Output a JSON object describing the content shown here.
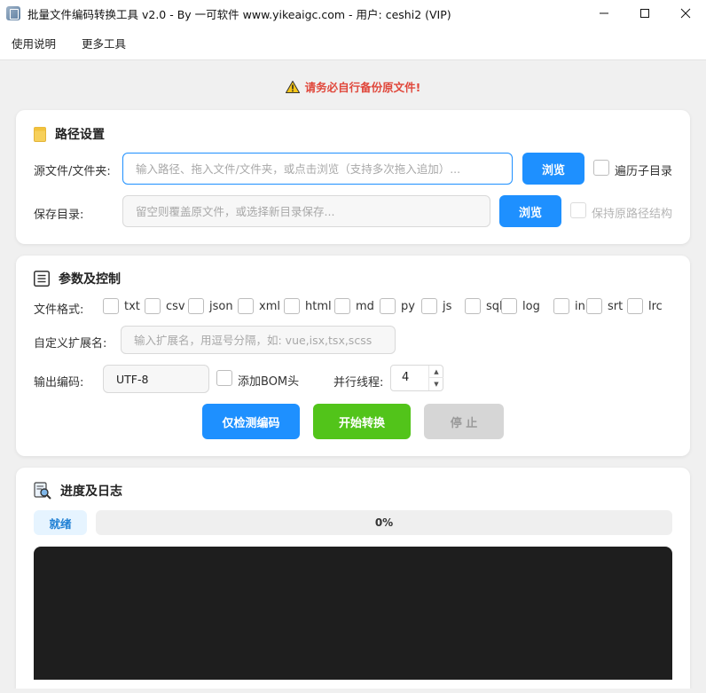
{
  "window": {
    "title": "批量文件编码转换工具 v2.0 - By 一可软件 www.yikeaigc.com - 用户: ceshi2 (VIP)"
  },
  "menu": {
    "items": [
      "使用说明",
      "更多工具"
    ]
  },
  "warning": {
    "text": "请务必自行备份原文件!"
  },
  "path_section": {
    "title": "路径设置",
    "source_label": "源文件/文件夹:",
    "source_placeholder": "输入路径、拖入文件/文件夹，或点击浏览（支持多次拖入追加）...",
    "browse_label": "浏览",
    "recurse_label": "遍历子目录",
    "save_label": "保存目录:",
    "save_placeholder": "留空则覆盖原文件，或选择新目录保存...",
    "browse2_label": "浏览",
    "keep_structure_label": "保持原路径结构"
  },
  "params_section": {
    "title": "参数及控制",
    "format_label": "文件格式:",
    "formats": [
      "txt",
      "csv",
      "json",
      "xml",
      "html",
      "md",
      "py",
      "js",
      "sql",
      "log",
      "ini",
      "srt",
      "lrc"
    ],
    "custom_ext_label": "自定义扩展名:",
    "custom_ext_placeholder": "输入扩展名，用逗号分隔，如: vue,isx,tsx,scss",
    "output_encoding_label": "输出编码:",
    "output_encoding_value": "UTF-8",
    "bom_label": "添加BOM头",
    "threads_label": "并行线程:",
    "threads_value": "4",
    "detect_button": "仅检测编码",
    "start_button": "开始转换",
    "stop_button": "停 止"
  },
  "progress_section": {
    "title": "进度及日志",
    "status": "就绪",
    "percent": 0,
    "percent_text": "0%"
  },
  "colors": {
    "accent": "#1e90ff",
    "success": "#52c41a",
    "warning": "#e0483c"
  },
  "icons": {
    "folder": "folder-icon",
    "params": "list-icon",
    "log": "search-document-icon",
    "warning": "warning-icon"
  }
}
